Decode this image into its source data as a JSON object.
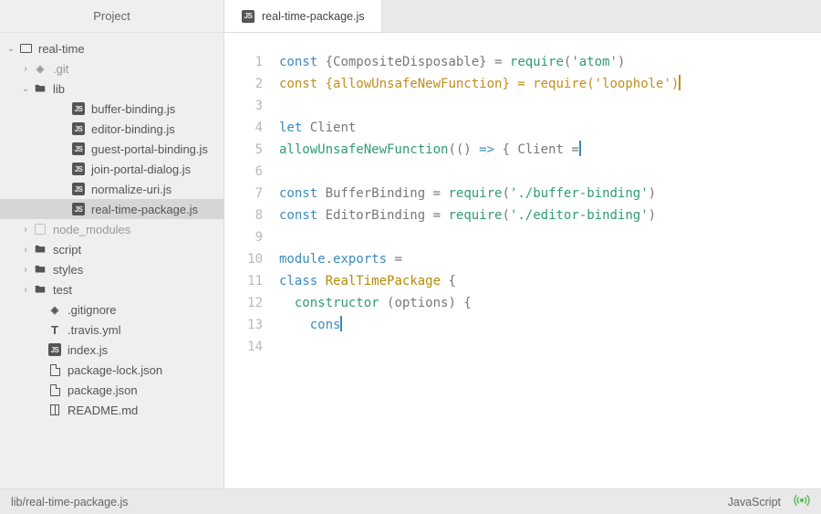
{
  "sidebar": {
    "title": "Project",
    "tree": [
      {
        "label": "real-time",
        "icon": "root",
        "indent": 0,
        "expanded": true,
        "dir": true
      },
      {
        "label": ".git",
        "icon": "git",
        "indent": 1,
        "expanded": false,
        "dir": true,
        "muted": true
      },
      {
        "label": "lib",
        "icon": "folder",
        "indent": 1,
        "expanded": true,
        "dir": true
      },
      {
        "label": "buffer-binding.js",
        "icon": "js",
        "indent": 3,
        "dir": false
      },
      {
        "label": "editor-binding.js",
        "icon": "js",
        "indent": 3,
        "dir": false
      },
      {
        "label": "guest-portal-binding.js",
        "icon": "js",
        "indent": 3,
        "dir": false
      },
      {
        "label": "join-portal-dialog.js",
        "icon": "js",
        "indent": 3,
        "dir": false
      },
      {
        "label": "normalize-uri.js",
        "icon": "js",
        "indent": 3,
        "dir": false
      },
      {
        "label": "real-time-package.js",
        "icon": "js",
        "indent": 3,
        "dir": false,
        "selected": true
      },
      {
        "label": "node_modules",
        "icon": "nm",
        "indent": 1,
        "expanded": false,
        "dir": true,
        "muted": true
      },
      {
        "label": "script",
        "icon": "folder",
        "indent": 1,
        "expanded": false,
        "dir": true
      },
      {
        "label": "styles",
        "icon": "folder",
        "indent": 1,
        "expanded": false,
        "dir": true
      },
      {
        "label": "test",
        "icon": "folder",
        "indent": 1,
        "expanded": false,
        "dir": true
      },
      {
        "label": ".gitignore",
        "icon": "git",
        "indent": 2,
        "dir": false
      },
      {
        "label": ".travis.yml",
        "icon": "travis",
        "indent": 2,
        "dir": false
      },
      {
        "label": "index.js",
        "icon": "js",
        "indent": 2,
        "dir": false
      },
      {
        "label": "package-lock.json",
        "icon": "json",
        "indent": 2,
        "dir": false
      },
      {
        "label": "package.json",
        "icon": "json",
        "indent": 2,
        "dir": false
      },
      {
        "label": "README.md",
        "icon": "book",
        "indent": 2,
        "dir": false
      }
    ]
  },
  "tab": {
    "label": "real-time-package.js"
  },
  "code": {
    "lines": [
      {
        "n": 1,
        "tokens": [
          [
            "kw",
            "const"
          ],
          [
            "p",
            " {"
          ],
          [
            "id",
            "CompositeDisposable"
          ],
          [
            "p",
            "} = "
          ],
          [
            "func",
            "require"
          ],
          [
            "p",
            "("
          ],
          [
            "str",
            "'atom'"
          ],
          [
            "p",
            ")"
          ]
        ]
      },
      {
        "n": 2,
        "hl": true,
        "cursor": true,
        "tokens": [
          [
            "kw",
            "const"
          ],
          [
            "p",
            " {"
          ],
          [
            "id",
            "allowUnsafeNewFunction"
          ],
          [
            "p",
            "} = "
          ],
          [
            "func",
            "require"
          ],
          [
            "p",
            "("
          ],
          [
            "str",
            "'loophole'"
          ],
          [
            "p",
            ")"
          ]
        ]
      },
      {
        "n": 3,
        "tokens": []
      },
      {
        "n": 4,
        "tokens": [
          [
            "kw",
            "let"
          ],
          [
            "p",
            " "
          ],
          [
            "id",
            "Client"
          ]
        ]
      },
      {
        "n": 5,
        "cursor": true,
        "tokens": [
          [
            "func",
            "allowUnsafeNewFunction"
          ],
          [
            "p",
            "(() "
          ],
          [
            "kw",
            "=>"
          ],
          [
            "p",
            " { "
          ],
          [
            "id",
            "Client"
          ],
          [
            "p",
            " ="
          ]
        ]
      },
      {
        "n": 6,
        "tokens": []
      },
      {
        "n": 7,
        "tokens": [
          [
            "kw",
            "const"
          ],
          [
            "p",
            " "
          ],
          [
            "id",
            "BufferBinding"
          ],
          [
            "p",
            " = "
          ],
          [
            "func",
            "require"
          ],
          [
            "p",
            "("
          ],
          [
            "str",
            "'./buffer-binding'"
          ],
          [
            "p",
            ")"
          ]
        ]
      },
      {
        "n": 8,
        "tokens": [
          [
            "kw",
            "const"
          ],
          [
            "p",
            " "
          ],
          [
            "id",
            "EditorBinding"
          ],
          [
            "p",
            " = "
          ],
          [
            "func",
            "require"
          ],
          [
            "p",
            "("
          ],
          [
            "str",
            "'./editor-binding'"
          ],
          [
            "p",
            ")"
          ]
        ]
      },
      {
        "n": 9,
        "tokens": []
      },
      {
        "n": 10,
        "tokens": [
          [
            "mod",
            "module"
          ],
          [
            "p",
            "."
          ],
          [
            "mod",
            "exports"
          ],
          [
            "p",
            " ="
          ]
        ]
      },
      {
        "n": 11,
        "tokens": [
          [
            "kw",
            "class"
          ],
          [
            "p",
            " "
          ],
          [
            "class",
            "RealTimePackage"
          ],
          [
            "p",
            " {"
          ]
        ]
      },
      {
        "n": 12,
        "tokens": [
          [
            "p",
            "  "
          ],
          [
            "func",
            "constructor"
          ],
          [
            "p",
            " ("
          ],
          [
            "id",
            "options"
          ],
          [
            "p",
            ") {"
          ]
        ]
      },
      {
        "n": 13,
        "cursor": true,
        "tokens": [
          [
            "p",
            "    "
          ],
          [
            "kw",
            "cons"
          ]
        ]
      },
      {
        "n": 14,
        "tokens": []
      }
    ]
  },
  "status": {
    "path": "lib/real-time-package.js",
    "language": "JavaScript"
  }
}
